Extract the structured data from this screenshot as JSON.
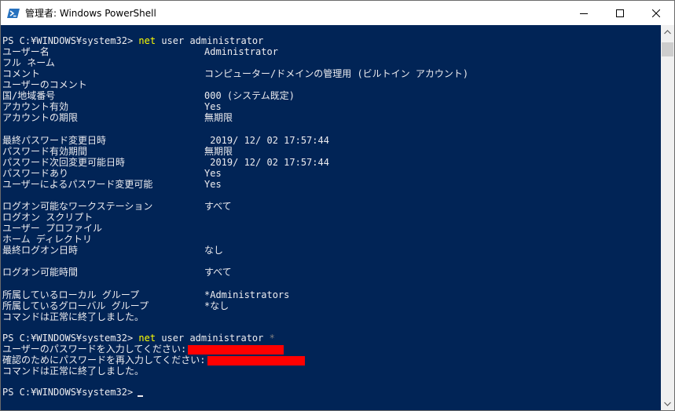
{
  "window": {
    "title": "管理者: Windows PowerShell",
    "app_icon": "powershell-icon",
    "minimize_icon": "minimize-icon",
    "maximize_icon": "maximize-icon",
    "close_icon": "close-icon"
  },
  "console": {
    "prompt": "PS C:¥WINDOWS¥system32>",
    "command1": {
      "cmd": "net",
      "args": "user administrator"
    },
    "fields1": [
      {
        "label": "ユーザー名",
        "value": "Administrator"
      },
      {
        "label": "フル ネーム",
        "value": ""
      },
      {
        "label": "コメント",
        "value": "コンピューター/ドメインの管理用 (ビルトイン アカウント)"
      },
      {
        "label": "ユーザーのコメント",
        "value": ""
      },
      {
        "label": "国/地域番号",
        "value": "000 (システム既定)"
      },
      {
        "label": "アカウント有効",
        "value": "Yes"
      },
      {
        "label": "アカウントの期限",
        "value": "無期限"
      }
    ],
    "fields2": [
      {
        "label": "最終パスワード変更日時",
        "value": " 2019/ 12/ 02 17:57:44"
      },
      {
        "label": "パスワード有効期間",
        "value": "無期限"
      },
      {
        "label": "パスワード次回変更可能日時",
        "value": " 2019/ 12/ 02 17:57:44"
      },
      {
        "label": "パスワードあり",
        "value": "Yes"
      },
      {
        "label": "ユーザーによるパスワード変更可能",
        "value": "Yes"
      }
    ],
    "fields3": [
      {
        "label": "ログオン可能なワークステーション",
        "value": "すべて"
      },
      {
        "label": "ログオン スクリプト",
        "value": ""
      },
      {
        "label": "ユーザー プロファイル",
        "value": ""
      },
      {
        "label": "ホーム ディレクトリ",
        "value": ""
      },
      {
        "label": "最終ログオン日時",
        "value": "なし"
      }
    ],
    "fields4": [
      {
        "label": "ログオン可能時間",
        "value": "すべて"
      }
    ],
    "fields5": [
      {
        "label": "所属しているローカル グループ",
        "value": "*Administrators"
      },
      {
        "label": "所属しているグローバル グループ",
        "value": "*なし"
      }
    ],
    "completed1": "コマンドは正常に終了しました。",
    "command2": {
      "cmd": "net",
      "args": "user administrator",
      "op": "*"
    },
    "password_prompt": "ユーザーのパスワードを入力してください:",
    "confirm_prompt": "確認のためにパスワードを再入力してください:",
    "completed2": "コマンドは正常に終了しました。"
  },
  "colors": {
    "console_bg": "#012456",
    "console_fg": "#eeedf0",
    "command": "#ffff00",
    "operator": "#7f7f7f",
    "redaction": "#ff0000"
  }
}
